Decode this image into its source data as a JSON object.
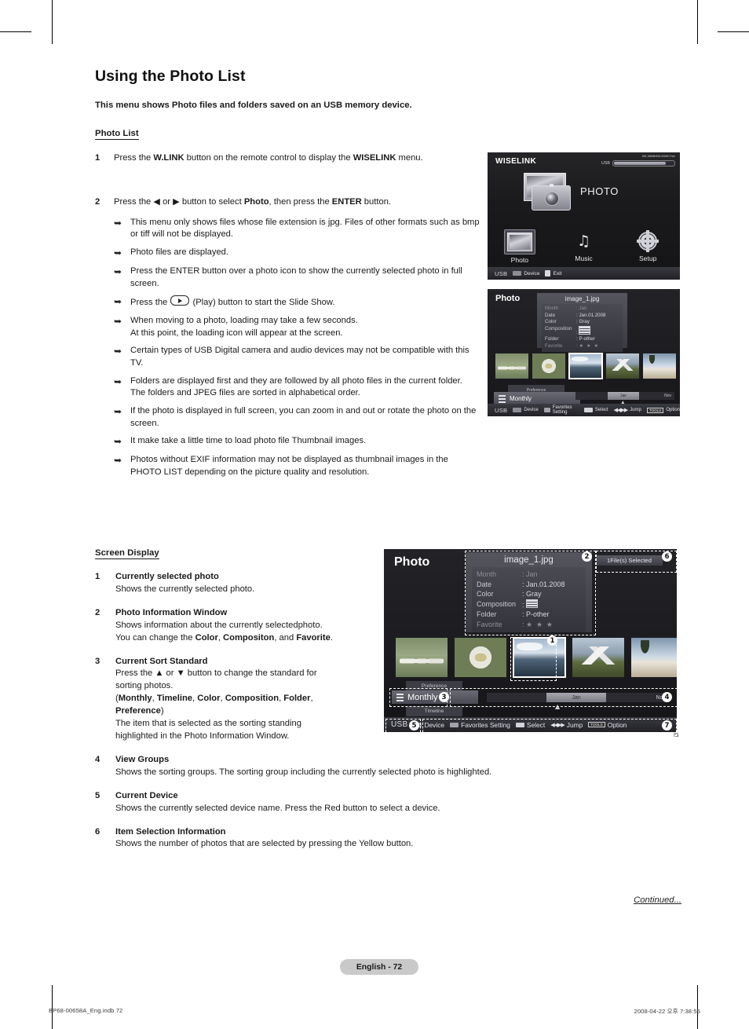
{
  "document": {
    "title": "Using the Photo List",
    "subtitle": "This menu shows Photo files and folders saved on an USB memory device.",
    "section_photo_list": "Photo List",
    "section_screen_display": "Screen Display",
    "continued": "Continued...",
    "page_badge": "English - 72",
    "footer_left": "BP68-00658A_Eng.indb   72",
    "footer_right": "2008-04-22   오후 7:38:55",
    "stray_text": "is"
  },
  "steps": [
    {
      "num": "1",
      "parts": [
        {
          "t": "Press the ",
          "b": false
        },
        {
          "t": "W.LINK",
          "b": true
        },
        {
          "t": " button on the remote control to display the ",
          "b": false
        },
        {
          "t": "WISELINK",
          "b": true
        },
        {
          "t": " menu.",
          "b": false
        }
      ]
    },
    {
      "num": "2",
      "parts": [
        {
          "t": "Press the ◀ or ▶ button to select ",
          "b": false
        },
        {
          "t": "Photo",
          "b": true
        },
        {
          "t": ", then press the ",
          "b": false
        },
        {
          "t": "ENTER",
          "b": true
        },
        {
          "t": " button.",
          "b": false
        }
      ]
    }
  ],
  "bullets": [
    {
      "text": "This menu only shows files whose file extension is jpg. Files of other formats such as bmp or tiff will not be displayed."
    },
    {
      "text": "Photo files are displayed."
    },
    {
      "text": "Press the ENTER button over a photo icon to show the currently selected photo in full screen."
    },
    {
      "text": "Press the  (Play) button to start the Slide Show.",
      "has_play_icon": true,
      "pre": "Press the ",
      "post": " (Play) button to start the Slide Show."
    },
    {
      "text": "When moving to a photo, loading may take a few seconds.\nAt this point, the loading icon will appear at the screen."
    },
    {
      "text": "Certain types of USB Digital camera and audio devices may not be compatible with this TV."
    },
    {
      "text": "Folders are displayed first and they are followed by all photo files in the current folder. The folders and JPEG files are sorted in alphabetical order."
    },
    {
      "text": "If the photo is displayed in full screen, you can zoom in and out or rotate the photo on the screen."
    },
    {
      "text": "It make take a little time to load photo file Thumbnail images."
    },
    {
      "text": "Photos without EXIF information may not be displayed as thumbnail images in the PHOTO LIST depending on the picture quality and resolution."
    }
  ],
  "screen_display_items": [
    {
      "num": "1",
      "title": "Currently selected photo",
      "lines": [
        {
          "parts": [
            {
              "t": "Shows the currently selected photo.",
              "b": false
            }
          ]
        }
      ]
    },
    {
      "num": "2",
      "title": "Photo Information Window",
      "lines": [
        {
          "parts": [
            {
              "t": "Shows information about the currently selectedphoto.",
              "b": false
            }
          ]
        },
        {
          "parts": [
            {
              "t": "You can change the ",
              "b": false
            },
            {
              "t": "Color",
              "b": true
            },
            {
              "t": ", ",
              "b": false
            },
            {
              "t": "Compositon",
              "b": true
            },
            {
              "t": ", and ",
              "b": false
            },
            {
              "t": "Favorite",
              "b": true
            },
            {
              "t": ".",
              "b": false
            }
          ]
        }
      ]
    },
    {
      "num": "3",
      "title": "Current Sort Standard",
      "lines": [
        {
          "parts": [
            {
              "t": "Press the ▲ or ▼ button to change the standard for",
              "b": false
            }
          ]
        },
        {
          "parts": [
            {
              "t": "sorting photos.",
              "b": false
            }
          ]
        },
        {
          "parts": [
            {
              "t": "(",
              "b": false
            },
            {
              "t": "Monthly",
              "b": true
            },
            {
              "t": ", ",
              "b": false
            },
            {
              "t": "Timeline",
              "b": true
            },
            {
              "t": ", ",
              "b": false
            },
            {
              "t": "Color",
              "b": true
            },
            {
              "t": ", ",
              "b": false
            },
            {
              "t": "Composition",
              "b": true
            },
            {
              "t": ", ",
              "b": false
            },
            {
              "t": "Folder",
              "b": true
            },
            {
              "t": ",",
              "b": false
            }
          ]
        },
        {
          "parts": [
            {
              "t": "Preference",
              "b": true
            },
            {
              "t": ")",
              "b": false
            }
          ]
        },
        {
          "parts": [
            {
              "t": "The item that is selected as the sorting standing",
              "b": false
            }
          ]
        },
        {
          "parts": [
            {
              "t": "highlighted in the Photo Information Window.",
              "b": false
            }
          ]
        }
      ]
    },
    {
      "num": "4",
      "title": "View Groups",
      "lines": [
        {
          "parts": [
            {
              "t": "Shows the sorting groups. The sorting group including the currently selected photo is highlighted.",
              "b": false
            }
          ]
        }
      ]
    },
    {
      "num": "5",
      "title": "Current Device",
      "lines": [
        {
          "parts": [
            {
              "t": "Shows the currently selected device name. Press the Red button to select a device.",
              "b": false
            }
          ]
        }
      ]
    },
    {
      "num": "6",
      "title": "Item Selection Information",
      "lines": [
        {
          "parts": [
            {
              "t": "Shows the number of photos that are selected by pressing the Yellow button.",
              "b": false
            }
          ]
        }
      ]
    }
  ],
  "tv_wiselink": {
    "header": "WISELINK",
    "usb_label": "USB",
    "capacity": "851.98MB/955.00MB Free",
    "big_label": "PHOTO",
    "menu": [
      {
        "label": "Photo",
        "icon": "photo-icon",
        "selected": true
      },
      {
        "label": "Music",
        "icon": "music-note-icon",
        "selected": false
      },
      {
        "label": "Setup",
        "icon": "gear-icon",
        "selected": false
      }
    ],
    "bottom_bar": {
      "device_label": "USB",
      "items": [
        {
          "key": "red",
          "label": "Device"
        },
        {
          "key": "exit",
          "label": "Exit"
        }
      ]
    }
  },
  "tv_photo": {
    "header": "Photo",
    "filename": "image_1.jpg",
    "info_rows": [
      {
        "key": "Month",
        "value": ": Jan",
        "dim": true
      },
      {
        "key": "Date",
        "value": ": Jan.01.2008",
        "dim": false
      },
      {
        "key": "Color",
        "value": ": Gray",
        "dim": false
      },
      {
        "key": "Composition",
        "value": ":",
        "icon": "composition-icon",
        "dim": false
      },
      {
        "key": "Folder",
        "value": ": P-other",
        "dim": false
      },
      {
        "key": "Favorite",
        "value": ":",
        "stars": "★ ★ ★",
        "dim": true
      }
    ],
    "thumbnails": [
      {
        "name": "sheep-photo",
        "selected": false
      },
      {
        "name": "flower-photo",
        "selected": false
      },
      {
        "name": "sea-photo",
        "selected": true
      },
      {
        "name": "mountain-photo",
        "selected": false
      },
      {
        "name": "palm-photo",
        "selected": false
      }
    ],
    "sort": {
      "above": "Preference",
      "current": "Monthly",
      "below": "Timeline"
    },
    "groups": {
      "highlighted": "Jan",
      "last": "Nov"
    },
    "selection_badge": "1File(s) Selected",
    "bottom_bar": {
      "device_label": "USB",
      "items": [
        {
          "key": "red",
          "label": "Device"
        },
        {
          "key": "green",
          "label": "Favorites Setting"
        },
        {
          "key": "yellow",
          "label": "Select"
        },
        {
          "key": "jump",
          "label": "Jump",
          "glyph": "◀◀▶▶"
        },
        {
          "key": "tools",
          "label": "Option",
          "glyph": "TOOLS"
        }
      ]
    }
  },
  "callouts": [
    "1",
    "2",
    "3",
    "4",
    "5",
    "6",
    "7"
  ]
}
